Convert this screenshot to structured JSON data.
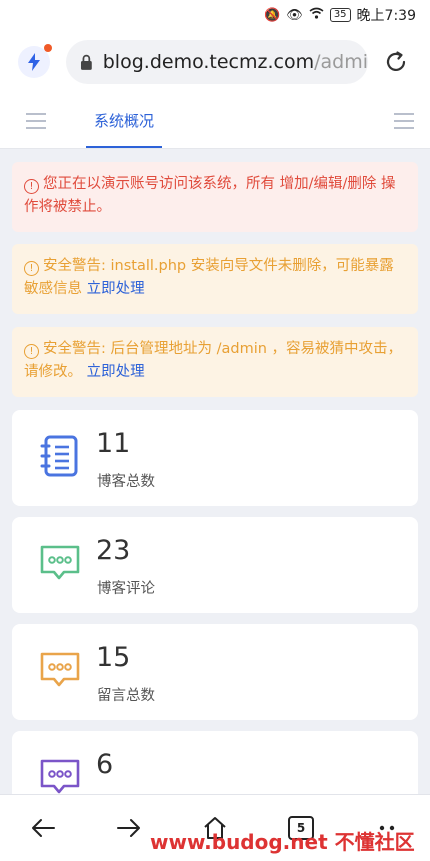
{
  "status_bar": {
    "battery": "35",
    "time": "晚上7:39"
  },
  "browser": {
    "url_host": "blog.demo.tecmz.com",
    "url_path": "/admi"
  },
  "tabs": {
    "active": "系统概况"
  },
  "alerts": {
    "error": "您正在以演示账号访问该系统，所有 增加/编辑/删除 操作将被禁止。",
    "warn1_text": "安全警告: install.php 安装向导文件未删除，可能暴露敏感信息",
    "warn1_link": "立即处理",
    "warn2_text": "安全警告: 后台管理地址为 /admin ，容易被猜中攻击，请修改。",
    "warn2_link": "立即处理"
  },
  "stats": [
    {
      "value": "11",
      "label": "博客总数",
      "icon": "notebook-icon",
      "color": "#4a74e0"
    },
    {
      "value": "23",
      "label": "博客评论",
      "icon": "comment-icon",
      "color": "#5bbf8a"
    },
    {
      "value": "15",
      "label": "留言总数",
      "icon": "message-icon",
      "color": "#e9a44a"
    },
    {
      "value": "6",
      "label": "",
      "icon": "chat-icon",
      "color": "#7b55c8"
    }
  ],
  "bottom_nav": {
    "tab_count": "5"
  },
  "watermark": "www.budog.net 不懂社区"
}
